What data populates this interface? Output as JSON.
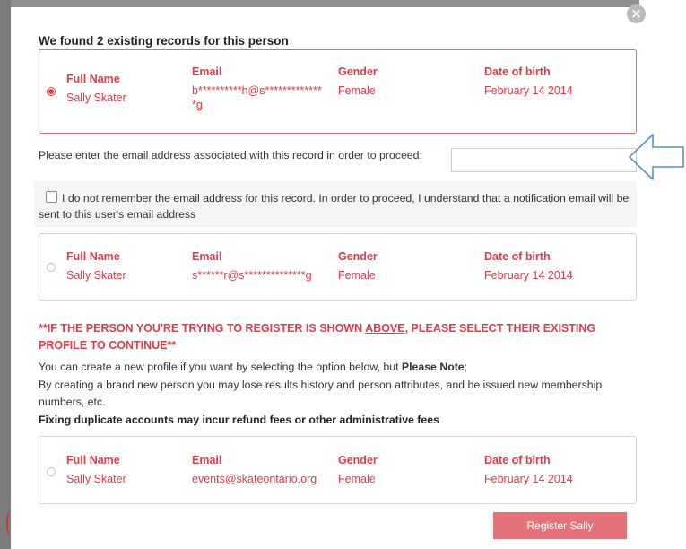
{
  "dialog": {
    "title": "We found 2 existing records for this person",
    "close_symbol": "×"
  },
  "headers": {
    "full_name": "Full Name",
    "email": "Email",
    "gender": "Gender",
    "dob": "Date of birth"
  },
  "records": [
    {
      "name": "Sally Skater",
      "email_line1": "b**********h@s*************",
      "email_line2": "*g",
      "gender": "Female",
      "dob": "February 14 2014",
      "selected": true
    },
    {
      "name": "Sally Skater",
      "email_line1": "s******r@s**************g",
      "email_line2": "",
      "gender": "Female",
      "dob": "February 14 2014",
      "selected": false
    }
  ],
  "new_profile": {
    "name": "Sally Skater",
    "email": "events@skateontario.org",
    "gender": "Female",
    "dob": "February 14 2014",
    "selected": false
  },
  "email_prompt": {
    "label": "Please enter the email address associated with this record in order to proceed:",
    "value": "",
    "placeholder": ""
  },
  "notice": {
    "checked": false,
    "text": "I do not remember the email address for this record. In order to proceed, I understand that a notification email will be sent to this user's email address"
  },
  "warning": {
    "part1": "**IF THE PERSON YOU'RE TRYING TO REGISTER IS SHOWN ",
    "underlined": "ABOVE",
    "part2": ", PLEASE SELECT THEIR EXISTING PROFILE TO CONTINUE**"
  },
  "info": {
    "line1_prefix": "You can create a new profile if you want by selecting the option below, but ",
    "line1_bold": "Please Note",
    "line1_suffix": ";",
    "line2": "By creating a brand new person you may lose results history and person attributes, and be issued new membership numbers, etc.",
    "line3": "Fixing duplicate accounts may incur refund fees or other administrative fees"
  },
  "register_button": "Register Sally",
  "colors": {
    "accent": "#e53945",
    "button": "#e3727b",
    "selected_border": "#e06b73",
    "arrow": "#5b8ec9"
  }
}
